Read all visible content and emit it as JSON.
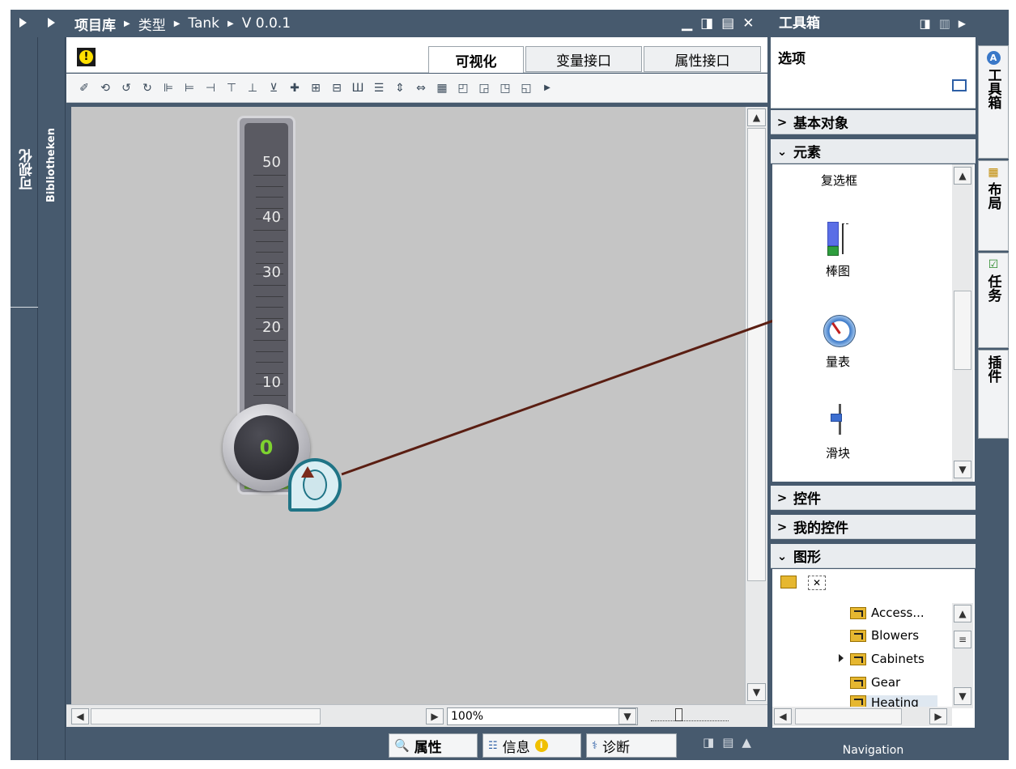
{
  "breadcrumb": {
    "items": [
      "项目库",
      "类型",
      "Tank",
      "V 0.0.1"
    ]
  },
  "left_panels": {
    "visualize_label": "可视化",
    "libraries_label": "Bibliotheken"
  },
  "editor": {
    "tabs": [
      {
        "label": "可视化"
      },
      {
        "label": "变量接口"
      },
      {
        "label": "属性接口"
      }
    ],
    "zoom_value": "100%",
    "bar_widget": {
      "ticks": [
        "50",
        "40",
        "30",
        "20",
        "10"
      ],
      "value": "0",
      "range_min": 0,
      "range_max": 60
    }
  },
  "bottom_tabs": [
    {
      "label": "属性"
    },
    {
      "label": "信息"
    },
    {
      "label": "诊断"
    }
  ],
  "toolbox": {
    "title": "工具箱",
    "options_label": "选项",
    "sections": {
      "basic": "基本对象",
      "elements": "元素",
      "controls": "控件",
      "my_controls": "我的控件",
      "graphics": "图形"
    },
    "element_items": [
      {
        "label": "复选框"
      },
      {
        "label": "棒图"
      },
      {
        "label": "量表"
      },
      {
        "label": "滑块"
      }
    ],
    "graphics_folders": [
      {
        "label": "Access..."
      },
      {
        "label": "Blowers"
      },
      {
        "label": "Cabinets"
      },
      {
        "label": "Gear"
      },
      {
        "label": "Heating"
      }
    ],
    "navigation_label": "Navigation"
  },
  "side_tabs": [
    {
      "label": "工具箱"
    },
    {
      "label": "布局"
    },
    {
      "label": "任务"
    },
    {
      "label": "插件"
    }
  ],
  "icons": [
    "expand-arrow-icon",
    "warning-icon",
    "brush-icon",
    "align-left-icon",
    "chevron-down-icon",
    "mouse-cursor-icon",
    "gauge-icon",
    "bar-chart-icon",
    "slider-icon",
    "folder-icon",
    "properties-icon",
    "info-icon",
    "diagnostics-icon"
  ],
  "colors": {
    "frame": "#475a6e",
    "canvas": "#c5c5c5",
    "warning": "#ffe000",
    "bar_fill": "#5a6ee6",
    "drag_line": "#5a1e12"
  }
}
